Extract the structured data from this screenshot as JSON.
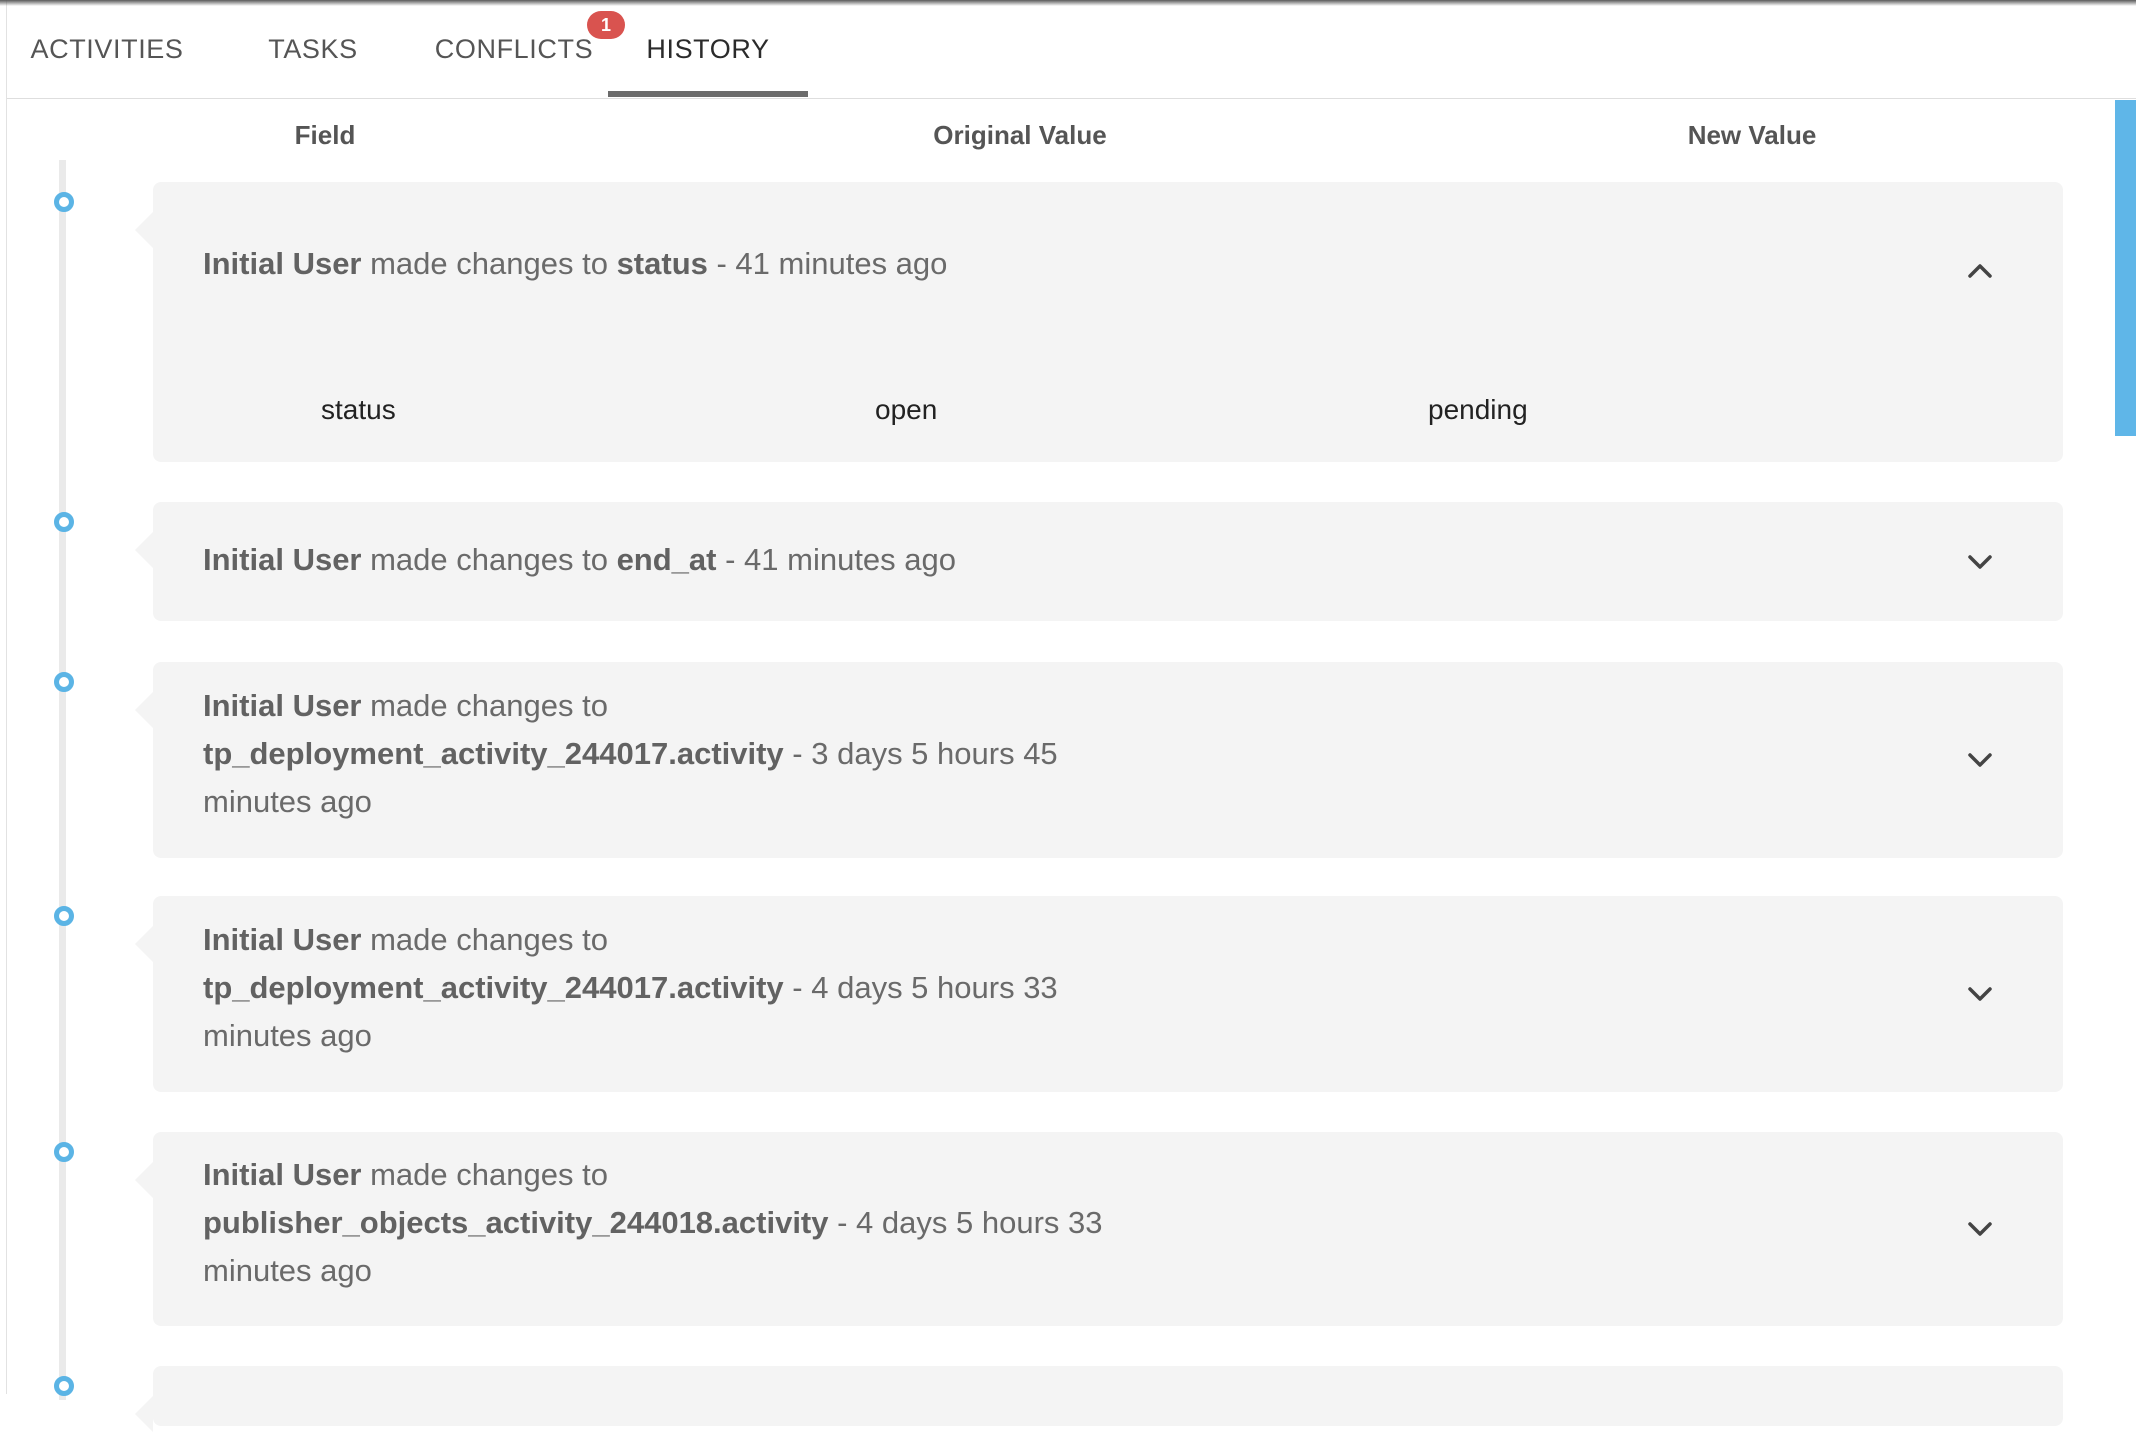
{
  "tabs": [
    {
      "label": "ACTIVITIES"
    },
    {
      "label": "TASKS"
    },
    {
      "label": "CONFLICTS",
      "badge": "1"
    },
    {
      "label": "HISTORY",
      "active": true
    }
  ],
  "columns": {
    "field": "Field",
    "original": "Original Value",
    "new": "New Value"
  },
  "history": [
    {
      "user": "Initial User",
      "verb": " made changes to ",
      "target": "status",
      "time": " - 41 minutes ago",
      "expanded": true,
      "detail": {
        "field": "status",
        "original": "open",
        "new": "pending"
      }
    },
    {
      "user": "Initial User",
      "verb": " made changes to ",
      "target": "end_at",
      "time": " - 41 minutes ago",
      "expanded": false
    },
    {
      "user": "Initial User",
      "verb": " made changes to ",
      "target": "tp_deployment_activity_244017.activity",
      "time": " - 3 days 5 hours 45 minutes ago",
      "expanded": false
    },
    {
      "user": "Initial User",
      "verb": " made changes to ",
      "target": "tp_deployment_activity_244017.activity",
      "time": " - 4 days 5 hours 33 minutes ago",
      "expanded": false
    },
    {
      "user": "Initial User",
      "verb": " made changes to ",
      "target": "publisher_objects_activity_244018.activity",
      "time": " - 4 days 5 hours 33 minutes ago",
      "expanded": false
    }
  ],
  "colors": {
    "accent": "#5bb4e5",
    "badge": "#d9534f",
    "card": "#f4f4f4"
  },
  "icons": {
    "expanded": "chevron-up-icon",
    "collapsed": "chevron-down-icon"
  }
}
